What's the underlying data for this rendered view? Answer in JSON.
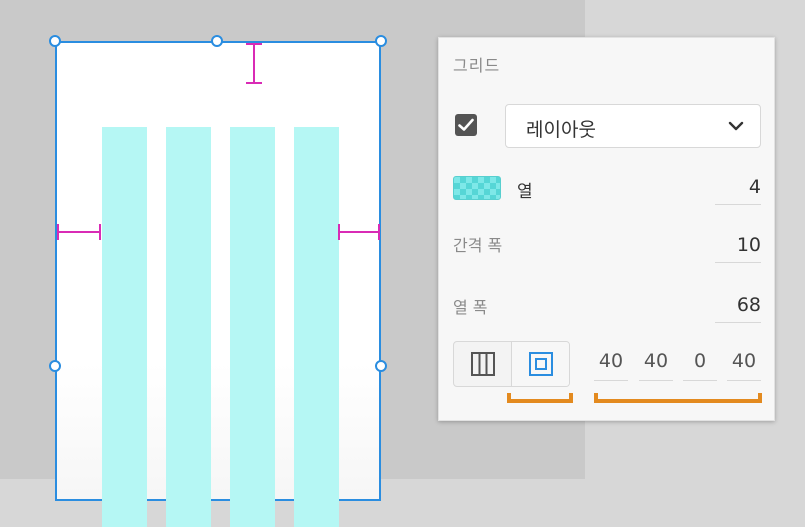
{
  "panel": {
    "title": "그리드",
    "layout_enabled": true,
    "layout_dropdown": {
      "selected": "레이아웃"
    },
    "columns": {
      "label": "열",
      "value": "4",
      "swatch_color": "#7ee8e8"
    },
    "gutter_width": {
      "label": "간격 폭",
      "value": "10"
    },
    "column_width": {
      "label": "열 폭",
      "value": "68"
    },
    "margins": {
      "values": [
        "40",
        "40",
        "0",
        "40"
      ]
    }
  },
  "colors": {
    "selection": "#2a8de0",
    "grid_column": "#b5f7f4",
    "margin_marker": "#d92bb5",
    "annotation": "#e38a1f"
  }
}
